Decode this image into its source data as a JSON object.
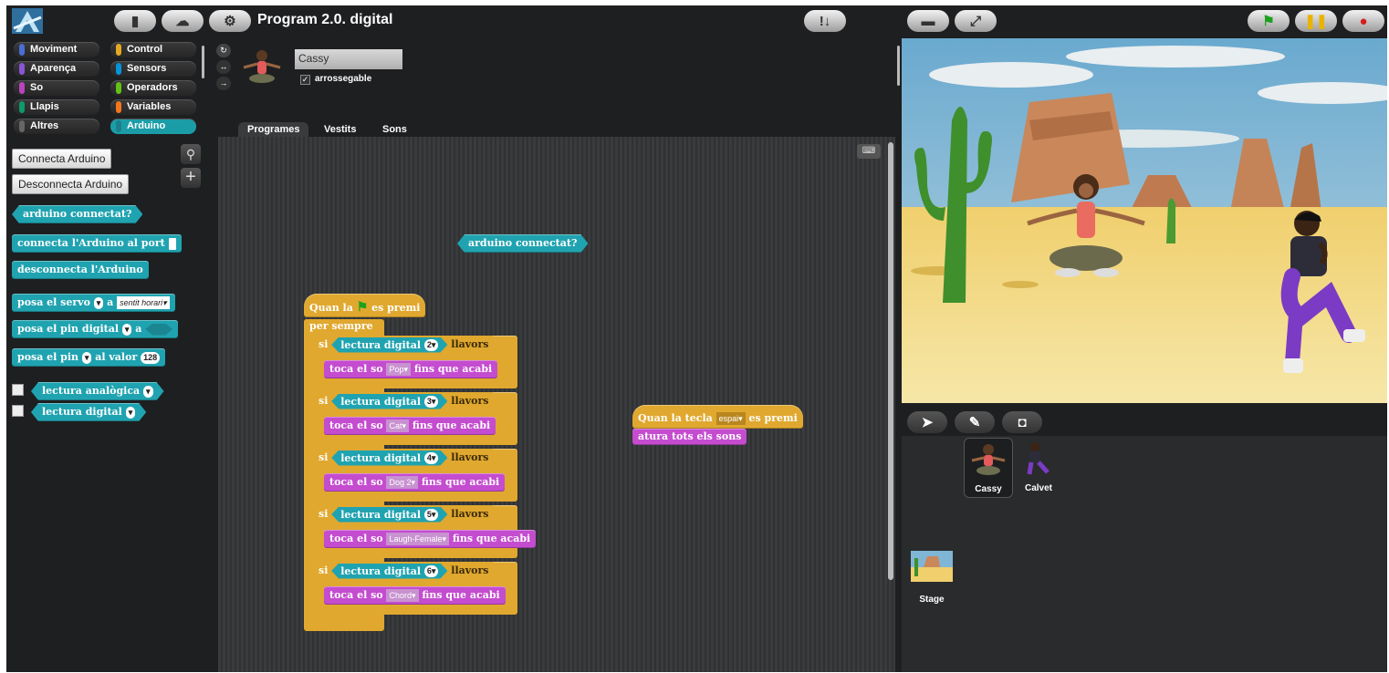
{
  "app": {
    "title": "Program 2.0. digital"
  },
  "categories": [
    {
      "label": "Moviment",
      "color": "#4a6cd4"
    },
    {
      "label": "Control",
      "color": "#e6a822"
    },
    {
      "label": "Aparença",
      "color": "#8a55d7"
    },
    {
      "label": "Sensors",
      "color": "#0494dc"
    },
    {
      "label": "So",
      "color": "#bb42c3"
    },
    {
      "label": "Operadors",
      "color": "#62c213"
    },
    {
      "label": "Llapis",
      "color": "#0e9a6c"
    },
    {
      "label": "Variables",
      "color": "#f3761d"
    },
    {
      "label": "Altres",
      "color": "#666666"
    },
    {
      "label": "Arduino",
      "color": "#20a3b0"
    }
  ],
  "palette": {
    "connect_label": "Connecta Arduino",
    "disconnect_label": "Desconnecta Arduino",
    "blocks": {
      "connected": "arduino connectat?",
      "connect_port": "connecta l'Arduino al port",
      "disconnect": "desconnecta l'Arduino",
      "servo_a": "posa el servo",
      "servo_b": "a",
      "servo_dd": "sentit horari",
      "pin_digital_a": "posa el pin digital",
      "pin_digital_b": "a",
      "pin_value_a": "posa el pin",
      "pin_value_b": "al valor",
      "pin_value_val": "128",
      "analog": "lectura analògica",
      "digital": "lectura digital"
    }
  },
  "sprite": {
    "name": "Cassy",
    "draggable_label": "arrossegable",
    "draggable": true
  },
  "tabs": [
    "Programes",
    "Vestits",
    "Sons"
  ],
  "script": {
    "loose_block": "arduino connectat?",
    "hat": {
      "pre": "Quan la",
      "post": "es premi"
    },
    "forever": "per sempre",
    "if_word": "si",
    "reading": "lectura digital",
    "then_word": "llavors",
    "play_pre": "toca el so",
    "play_post": "fins que acabi",
    "ifs": [
      {
        "pin": "2",
        "sound": "Pop"
      },
      {
        "pin": "3",
        "sound": "Cat"
      },
      {
        "pin": "4",
        "sound": "Dog 2"
      },
      {
        "pin": "5",
        "sound": "Laugh-Female"
      },
      {
        "pin": "6",
        "sound": "Chord"
      }
    ],
    "key_hat": {
      "pre": "Quan la tecla",
      "key": "espai",
      "post": "es premi"
    },
    "stop_sounds": "atura tots els sons"
  },
  "corral": {
    "sprites": [
      {
        "name": "Cassy"
      },
      {
        "name": "Calvet"
      }
    ],
    "stage_label": "Stage"
  }
}
